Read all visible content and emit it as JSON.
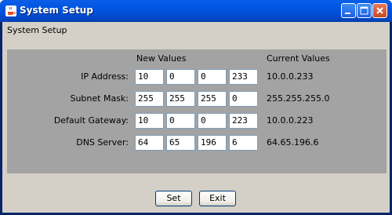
{
  "window": {
    "title": "System Setup",
    "heading": "System Setup"
  },
  "columns": {
    "new_values": "New Values",
    "current_values": "Current Values"
  },
  "rows": [
    {
      "label": "IP Address:",
      "values": [
        "10",
        "0",
        "0",
        "233"
      ],
      "current": "10.0.0.233"
    },
    {
      "label": "Subnet Mask:",
      "values": [
        "255",
        "255",
        "255",
        "0"
      ],
      "current": "255.255.255.0"
    },
    {
      "label": "Default Gateway:",
      "values": [
        "10",
        "0",
        "0",
        "223"
      ],
      "current": "10.0.0.223"
    },
    {
      "label": "DNS Server:",
      "values": [
        "64",
        "65",
        "196",
        "6"
      ],
      "current": "64.65.196.6"
    }
  ],
  "buttons": {
    "set": "Set",
    "exit": "Exit"
  },
  "icons": {
    "app": "java-cup-icon",
    "minimize": "minimize-icon",
    "maximize": "maximize-icon",
    "close": "close-icon"
  },
  "colors": {
    "titlebar": "#0054e3",
    "panel": "#a3a3a3",
    "background": "#d4d0c8"
  }
}
